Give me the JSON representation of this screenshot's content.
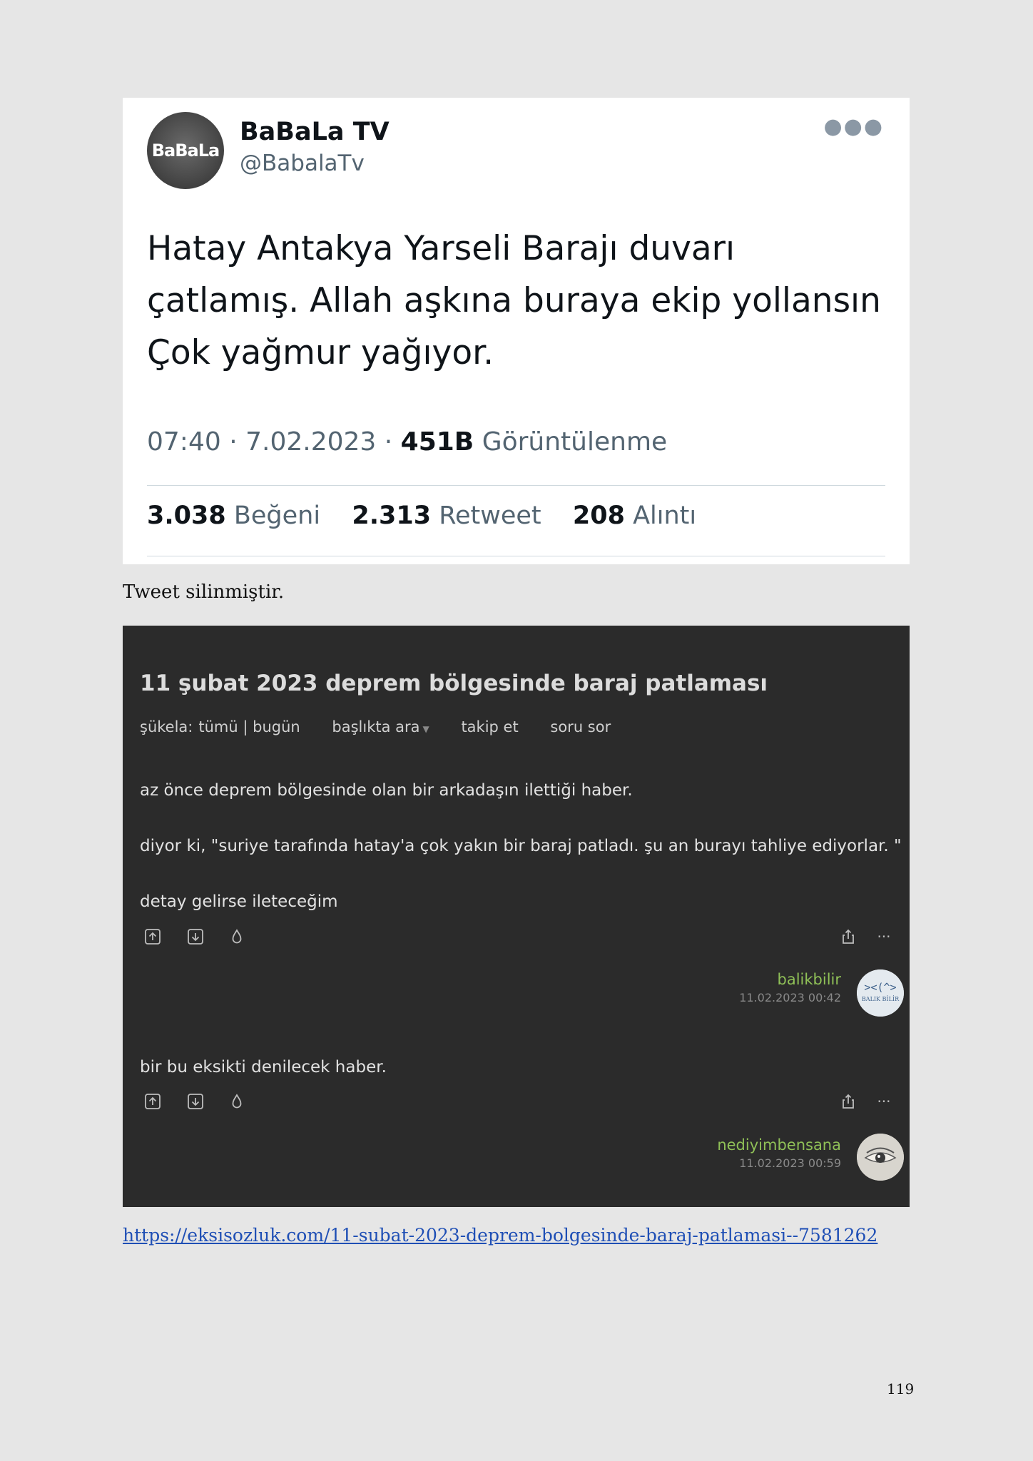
{
  "tweet": {
    "avatar_text": "BaBaLa",
    "name": "BaBaLa TV",
    "handle": "@BabalaTv",
    "more_icon": "more-horizontal-icon",
    "lines": [
      "Hatay Antakya Yarseli Barajı duvarı",
      "çatlamış. Allah aşkına buraya ekip yollansın",
      "Çok yağmur yağıyor."
    ],
    "time": "07:40",
    "date": "7.02.2023",
    "views_count": "451B",
    "views_label": "Görüntülenme",
    "likes_count": "3.038",
    "likes_label": "Beğeni",
    "retweets_count": "2.313",
    "retweets_label": "Retweet",
    "quotes_count": "208",
    "quotes_label": "Alıntı"
  },
  "caption": "Tweet silinmiştir.",
  "eksi": {
    "title": "11 şubat 2023 deprem bölgesinde baraj patlaması",
    "nav": {
      "sukela_label": "şükela:",
      "sukela_options": "tümü | bugün",
      "search_in_topic": "başlıkta ara",
      "follow": "takip et",
      "ask": "soru sor"
    },
    "entries": [
      {
        "paragraphs": [
          "az önce deprem bölgesinde olan bir arkadaşın ilettiği haber.",
          "diyor ki, \"suriye tarafında hatay'a çok yakın bir baraj patladı. şu an burayı tahliye ediyorlar. \"",
          "detay gelirse ileteceğim"
        ],
        "author": "balikbilir",
        "date": "11.02.2023 00:42"
      },
      {
        "paragraphs": [
          "bir bu eksikti denilecek haber."
        ],
        "author": "nediyimbensana",
        "date": "11.02.2023 00:59"
      }
    ],
    "colors": {
      "background": "#2b2b2b",
      "author_green": "#8fc057"
    }
  },
  "link": "https://eksisozluk.com/11-subat-2023-deprem-bolgesinde-baraj-patlamasi--7581262",
  "page_number": "119"
}
